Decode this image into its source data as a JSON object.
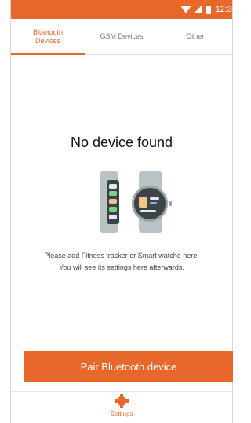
{
  "status_bar": {
    "time": "12:3",
    "wifi_icon": "wifi-icon",
    "signal_icon": "signal-icon",
    "battery_icon": "battery-icon"
  },
  "tabs": [
    {
      "label_line1": "Bluetooth",
      "label_line2": "Devices",
      "active": true
    },
    {
      "label": "GSM Devices",
      "active": false
    },
    {
      "label": "Other",
      "active": false
    }
  ],
  "empty_state": {
    "title": "No device found",
    "illustration_icons": [
      "fitness-tracker-icon",
      "smartwatch-icon"
    ],
    "hint_line1": "Please add Fitness tracker or Smart watche here.",
    "hint_line2": "You will see its settings here afterwards."
  },
  "pair_button": {
    "label": "Pair Bluetooth device"
  },
  "bottom_nav": {
    "settings_label": "Settings",
    "settings_icon": "gear-icon"
  },
  "colors": {
    "accent": "#e8672a",
    "device_body": "#b9c2c4",
    "device_screen": "#3d4448"
  }
}
